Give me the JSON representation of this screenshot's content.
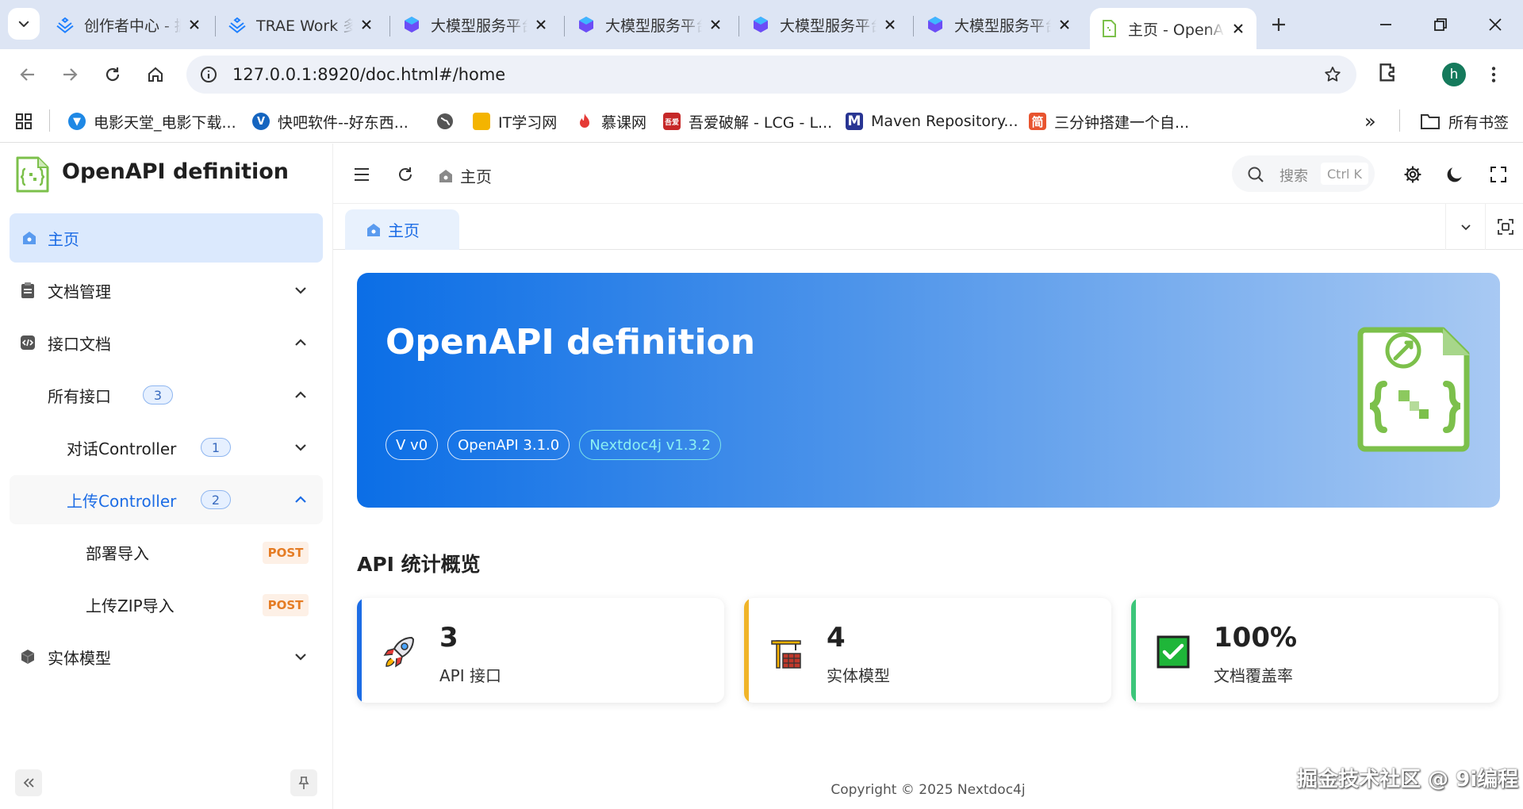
{
  "browser": {
    "tabs": [
      {
        "title": "创作者中心 - 掘金",
        "icon": "juejin-icon"
      },
      {
        "title": "TRAE Work 多智能体",
        "icon": "juejin-icon"
      },
      {
        "title": "大模型服务平台百炼",
        "icon": "bailian-icon"
      },
      {
        "title": "大模型服务平台百炼",
        "icon": "bailian-icon"
      },
      {
        "title": "大模型服务平台百炼",
        "icon": "bailian-icon"
      },
      {
        "title": "大模型服务平台百炼",
        "icon": "bailian-icon"
      },
      {
        "title": "主页 - OpenAPI definition",
        "icon": "openapi-icon",
        "active": true
      }
    ],
    "url": "127.0.0.1:8920/doc.html#/home",
    "profile_initial": "h",
    "bookmarks": [
      {
        "label": "电影天堂_电影下载...",
        "color": "#1e88e5"
      },
      {
        "label": "快吧软件--好东西...",
        "color": "#1565c0"
      },
      {
        "label": "",
        "color": "#555555"
      },
      {
        "label": "IT学习网",
        "color": "#f4b400"
      },
      {
        "label": "慕课网",
        "color": "#e53935"
      },
      {
        "label": "吾爱破解 - LCG - L...",
        "color": "#c62828"
      },
      {
        "label": "Maven Repository...",
        "color": "#283593"
      },
      {
        "label": "三分钟搭建一个自...",
        "color": "#e8542f"
      }
    ],
    "bookmarks_overflow": "»",
    "all_bookmarks": "所有书签"
  },
  "sidebar": {
    "app_title": "OpenAPI definition",
    "items": [
      {
        "label": "主页"
      },
      {
        "label": "文档管理"
      },
      {
        "label": "接口文档"
      },
      {
        "label": "所有接口",
        "badge": "3"
      },
      {
        "label": "对话Controller",
        "badge": "1"
      },
      {
        "label": "上传Controller",
        "badge": "2"
      },
      {
        "label": "部署导入",
        "method": "POST"
      },
      {
        "label": "上传ZIP导入",
        "method": "POST"
      },
      {
        "label": "实体模型"
      }
    ]
  },
  "header": {
    "breadcrumb": "主页",
    "search_placeholder": "搜索",
    "search_shortcut": "Ctrl K"
  },
  "tabbar": {
    "active_tab": "主页"
  },
  "hero": {
    "title": "OpenAPI definition",
    "tags": [
      "V v0",
      "OpenAPI 3.1.0",
      "Nextdoc4j v1.3.2"
    ]
  },
  "stats": {
    "title": "API 统计概览",
    "cards": [
      {
        "value": "3",
        "label": "API 接口",
        "color": "#1c6ce5",
        "icon": "rocket-icon"
      },
      {
        "value": "4",
        "label": "实体模型",
        "color": "#f0b429",
        "icon": "crane-icon"
      },
      {
        "value": "100%",
        "label": "文档覆盖率",
        "color": "#3cc67a",
        "icon": "check-icon"
      }
    ]
  },
  "footer": "Copyright © 2025 Nextdoc4j",
  "watermark": "掘金技术社区 @ 9i编程"
}
